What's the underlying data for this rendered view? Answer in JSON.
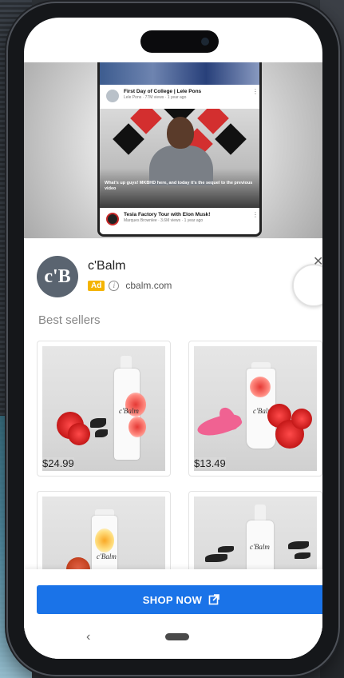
{
  "video": {
    "row1": {
      "title": "First Day of College | Lele Pons",
      "meta": "Lele Pons · 77M views · 1 year ago"
    },
    "caption": "What's up guys! MKBHD here, and today it's the sequel to the previous video",
    "row2": {
      "title": "Tesla Factory Tour with Elon Musk!",
      "meta": "Marques Brownlee · 3.6M views · 1 year ago"
    }
  },
  "ad": {
    "logo_text": "c'B",
    "brand_name": "c'Balm",
    "badge": "Ad",
    "info_glyph": "i",
    "domain": "cbalm.com",
    "close_glyph": "✕",
    "section_title": "Best sellers",
    "products": [
      {
        "price": "$24.99"
      },
      {
        "price": "$13.49"
      },
      {
        "price": ""
      },
      {
        "price": ""
      }
    ],
    "cta_label": "SHOP NOW"
  },
  "nav": {
    "back_glyph": "‹"
  },
  "colors": {
    "cta": "#1a73e8",
    "badge": "#f4b400",
    "logo_bg": "#5a6470"
  },
  "icons": [
    "info-icon",
    "close-icon",
    "external-link-icon",
    "back-icon",
    "home-pill"
  ]
}
